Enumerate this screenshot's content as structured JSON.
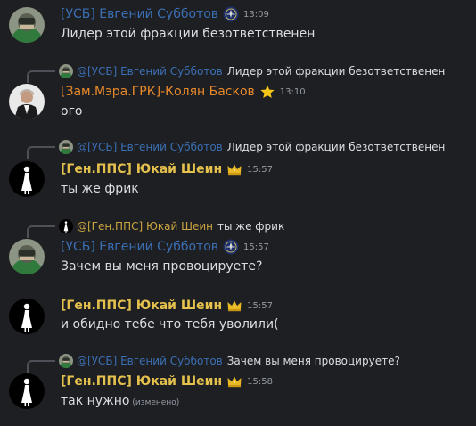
{
  "messages": [
    {
      "author": "[УСБ] Евгений Субботов",
      "time": "13:09",
      "text": "Лидер этой фракции безответственен",
      "badge_icon": "police-emblem-icon"
    },
    {
      "reply": {
        "author": "@[УСБ] Евгений Субботов",
        "text": "Лидер этой фракции безответственен"
      },
      "author": "[Зам.Мэра.ГРК]-Колян Басков",
      "time": "13:10",
      "text": "ого",
      "badge_icon": "star-icon"
    },
    {
      "reply": {
        "author": "@[УСБ] Евгений Субботов",
        "text": "Лидер этой фракции безответственен"
      },
      "author": "[Ген.ППС] Юкай Шеин",
      "time": "15:57",
      "text": "ты же фрик",
      "badge_icon": "crown-icon"
    },
    {
      "reply": {
        "author": "@[Ген.ППС] Юкай Шеин",
        "text": "ты же фрик"
      },
      "author": "[УСБ] Евгений Субботов",
      "time": "15:57",
      "text": "Зачем вы меня провоцируете?",
      "badge_icon": "police-emblem-icon"
    },
    {
      "author": "[Ген.ППС] Юкай Шеин",
      "time": "15:57",
      "text": "и обидно тебе что тебя уволили(",
      "badge_icon": "crown-icon"
    },
    {
      "reply": {
        "author": "@[УСБ] Евгений Субботов",
        "text": "Зачем вы меня провоцируете?"
      },
      "author": "[Ген.ППС] Юкай Шеин",
      "time": "15:58",
      "text": "так нужно",
      "edited": "(изменено)",
      "badge_icon": "crown-icon"
    }
  ],
  "colors": {
    "background": "#1e1f22",
    "usb_name": "#3b6fb5",
    "deputy_name": "#e98a2b",
    "pps_name": "#e4c04d"
  }
}
